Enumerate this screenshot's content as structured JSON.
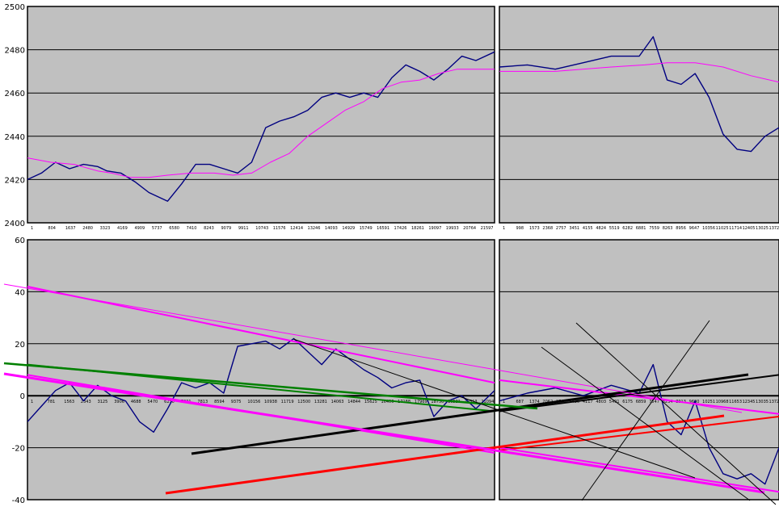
{
  "chart_data": [
    {
      "type": "line",
      "panel": "top-left",
      "ylim": [
        2400,
        2500
      ],
      "yticks": [
        "2500",
        "2480",
        "2460",
        "2440",
        "2420",
        "2400"
      ],
      "xticks": [
        "1",
        "804",
        "1637",
        "2480",
        "3323",
        "4169",
        "4909",
        "5737",
        "6580",
        "7410",
        "8243",
        "9079",
        "9911",
        "10743",
        "11576",
        "12414",
        "13246",
        "14093",
        "14929",
        "15749",
        "16591",
        "17426",
        "18261",
        "19097",
        "19933",
        "20764",
        "21597"
      ],
      "grid": true,
      "series": [
        {
          "role": "price",
          "color": "#000080",
          "x": [
            0,
            3,
            6,
            9,
            12,
            15,
            17,
            20,
            23,
            26,
            30,
            33,
            36,
            39,
            42,
            45,
            48,
            51,
            54,
            57,
            60,
            63,
            66,
            69,
            72,
            75,
            78,
            81,
            84,
            87,
            90,
            93,
            96,
            100
          ],
          "y": [
            2420,
            2423,
            2428,
            2425,
            2427,
            2426,
            2424,
            2423,
            2419,
            2414,
            2410,
            2418,
            2427,
            2427,
            2425,
            2423,
            2428,
            2444,
            2447,
            2449,
            2452,
            2458,
            2460,
            2458,
            2460,
            2458,
            2467,
            2473,
            2470,
            2466,
            2471,
            2477,
            2475,
            2479
          ]
        },
        {
          "role": "moving-average",
          "color": "#FF00FF",
          "x": [
            0,
            5,
            10,
            15,
            18,
            22,
            26,
            30,
            35,
            40,
            44,
            48,
            52,
            56,
            60,
            64,
            68,
            72,
            76,
            80,
            84,
            88,
            92,
            96,
            100
          ],
          "y": [
            2430,
            2428,
            2427,
            2424,
            2423,
            2421,
            2421,
            2422,
            2423,
            2423,
            2422,
            2423,
            2428,
            2432,
            2440,
            2446,
            2452,
            2456,
            2462,
            2465,
            2466,
            2469,
            2471,
            2471,
            2471
          ]
        }
      ]
    },
    {
      "type": "line",
      "panel": "top-right",
      "ylim": [
        2400,
        2500
      ],
      "xticks": [
        "1",
        "998",
        "1573",
        "2368",
        "2757",
        "3451",
        "4155",
        "4824",
        "5519",
        "6282",
        "6881",
        "7559",
        "8263",
        "8956",
        "9647",
        "10356",
        "11025",
        "11714",
        "12405",
        "13025",
        "13726"
      ],
      "grid": true,
      "series": [
        {
          "role": "price",
          "color": "#000080",
          "x": [
            0,
            10,
            20,
            30,
            40,
            50,
            55,
            60,
            65,
            70,
            75,
            80,
            85,
            90,
            95,
            100
          ],
          "y": [
            2472,
            2473,
            2471,
            2474,
            2477,
            2477,
            2486,
            2466,
            2464,
            2469,
            2458,
            2441,
            2434,
            2433,
            2440,
            2444
          ]
        },
        {
          "role": "moving-average",
          "color": "#FF00FF",
          "x": [
            0,
            20,
            40,
            52,
            60,
            70,
            80,
            90,
            100
          ],
          "y": [
            2470,
            2470,
            2472,
            2473,
            2474,
            2474,
            2472,
            2468,
            2465
          ]
        }
      ]
    },
    {
      "type": "line",
      "panel": "bottom-left",
      "ylim": [
        -40,
        60
      ],
      "yticks": [
        "60",
        "40",
        "20",
        "0",
        "-20",
        "-40"
      ],
      "xticks": [
        "1",
        "781",
        "1563",
        "2343",
        "3125",
        "3906",
        "4688",
        "5470",
        "6250",
        "7031",
        "7813",
        "8594",
        "9375",
        "10156",
        "10938",
        "11719",
        "12500",
        "13281",
        "14063",
        "14844",
        "15625",
        "16406",
        "17188",
        "17969",
        "18750",
        "19531",
        "20313",
        "21094"
      ],
      "grid": true,
      "series": [
        {
          "role": "detrended-price",
          "color": "#000080",
          "x": [
            0,
            3,
            6,
            9,
            12,
            15,
            18,
            21,
            24,
            27,
            30,
            33,
            36,
            39,
            42,
            45,
            48,
            51,
            54,
            57,
            60,
            63,
            66,
            69,
            72,
            75,
            78,
            81,
            84,
            87,
            90,
            93,
            96,
            100
          ],
          "y": [
            -10,
            -4,
            2,
            5,
            -2,
            4,
            0,
            -2,
            -10,
            -14,
            -5,
            5,
            3,
            5,
            1,
            19,
            20,
            21,
            18,
            22,
            17,
            12,
            18,
            14,
            10,
            7,
            3,
            5,
            6,
            -8,
            -2,
            0,
            -5,
            2
          ]
        },
        {
          "role": "trendline",
          "color": "#FF00FF",
          "x": [
            0,
            100
          ],
          "y": [
            42,
            5
          ]
        },
        {
          "role": "trendline",
          "color": "#008000",
          "x": [
            0,
            100
          ],
          "y": [
            12,
            -6
          ]
        },
        {
          "role": "trendline",
          "color": "#FF00FF",
          "x": [
            0,
            100
          ],
          "y": [
            8,
            -22
          ]
        }
      ]
    },
    {
      "type": "line",
      "panel": "bottom-right",
      "ylim": [
        -40,
        60
      ],
      "xticks": [
        "1",
        "687",
        "1374",
        "2062",
        "2749",
        "3436",
        "4117",
        "4803",
        "5491",
        "6175",
        "6859",
        "7547",
        "8234",
        "8913",
        "9600",
        "10251",
        "10968",
        "11653",
        "12345",
        "13035",
        "13721"
      ],
      "grid": true,
      "series": [
        {
          "role": "detrended-price",
          "color": "#000080",
          "x": [
            0,
            10,
            20,
            30,
            40,
            50,
            55,
            60,
            65,
            70,
            75,
            80,
            85,
            90,
            95,
            100
          ],
          "y": [
            -2,
            1,
            3,
            0,
            4,
            1,
            12,
            -10,
            -15,
            -2,
            -20,
            -30,
            -32,
            -30,
            -34,
            -20
          ]
        },
        {
          "role": "trendline",
          "color": "#FF00FF",
          "x": [
            0,
            100
          ],
          "y": [
            6,
            -7
          ]
        },
        {
          "role": "trendline",
          "color": "#000000",
          "x": [
            0,
            100
          ],
          "y": [
            -6,
            8
          ]
        },
        {
          "role": "trendline",
          "color": "#FF0000",
          "x": [
            0,
            100
          ],
          "y": [
            -21,
            -8
          ]
        },
        {
          "role": "trendline",
          "color": "#FF00FF",
          "x": [
            0,
            100
          ],
          "y": [
            -20,
            -37
          ]
        }
      ]
    }
  ],
  "overlays": [
    {
      "role": "trendline",
      "color": "#000000",
      "width": 3,
      "x1": 237,
      "y1": 562,
      "x2": 926,
      "y2": 464
    },
    {
      "role": "trendline",
      "color": "#FF0000",
      "width": 3,
      "x1": 205,
      "y1": 611,
      "x2": 896,
      "y2": 515
    },
    {
      "role": "trendline",
      "color": "#FF00FF",
      "width": 3,
      "x1": 5,
      "y1": 463,
      "x2": 946,
      "y2": 610
    },
    {
      "role": "trendline",
      "color": "#FF00FF",
      "width": 1,
      "x1": 5,
      "y1": 352,
      "x2": 918,
      "y2": 511
    },
    {
      "role": "trendline",
      "color": "#008000",
      "width": 2.5,
      "x1": 5,
      "y1": 450,
      "x2": 665,
      "y2": 506
    },
    {
      "role": "trendline",
      "color": "#000000",
      "width": 1,
      "x1": 363,
      "y1": 420,
      "x2": 860,
      "y2": 592
    },
    {
      "role": "trendline",
      "color": "#000000",
      "width": 1,
      "x1": 670,
      "y1": 430,
      "x2": 928,
      "y2": 620
    },
    {
      "role": "trendline",
      "color": "#000000",
      "width": 1,
      "x1": 713,
      "y1": 400,
      "x2": 960,
      "y2": 625
    },
    {
      "role": "trendline",
      "color": "#000000",
      "width": 1,
      "x1": 720,
      "y1": 620,
      "x2": 878,
      "y2": 397
    }
  ]
}
